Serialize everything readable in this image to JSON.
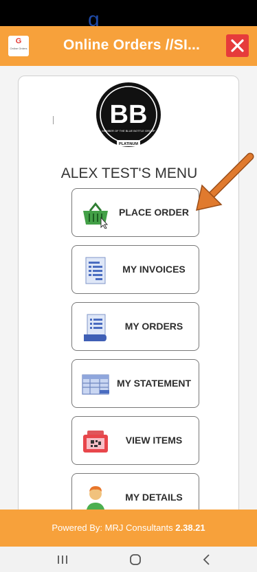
{
  "status_bar": {
    "partial_text": "g"
  },
  "app_bar": {
    "icon_letter": "G",
    "icon_caption": "Online Orders",
    "title": "Online Orders //SI...",
    "close_icon": "close-icon"
  },
  "menu": {
    "title": "ALEX TEST'S MENU",
    "logo": {
      "monogram": "BB",
      "tagline": "MEMBER OF THE BLUE BOTTLE GROUP",
      "tier": "PLATINUM"
    },
    "items": [
      {
        "label": "PLACE ORDER",
        "icon": "basket-icon"
      },
      {
        "label": "MY INVOICES",
        "icon": "invoice-icon"
      },
      {
        "label": "MY ORDERS",
        "icon": "orders-icon"
      },
      {
        "label": "MY STATEMENT",
        "icon": "statement-icon"
      },
      {
        "label": "VIEW ITEMS",
        "icon": "scanner-icon"
      },
      {
        "label": "MY DETAILS",
        "icon": "person-icon"
      }
    ]
  },
  "annotation": {
    "arrow_color": "#e07a2e"
  },
  "footer": {
    "powered_by": "Powered By: MRJ Consultants",
    "version": "2.38.21"
  },
  "colors": {
    "accent": "#f7a13b",
    "close": "#e63b3b",
    "text": "#2d2d2d"
  },
  "nav": {
    "recent": "recents-icon",
    "home": "home-icon",
    "back": "back-icon"
  }
}
